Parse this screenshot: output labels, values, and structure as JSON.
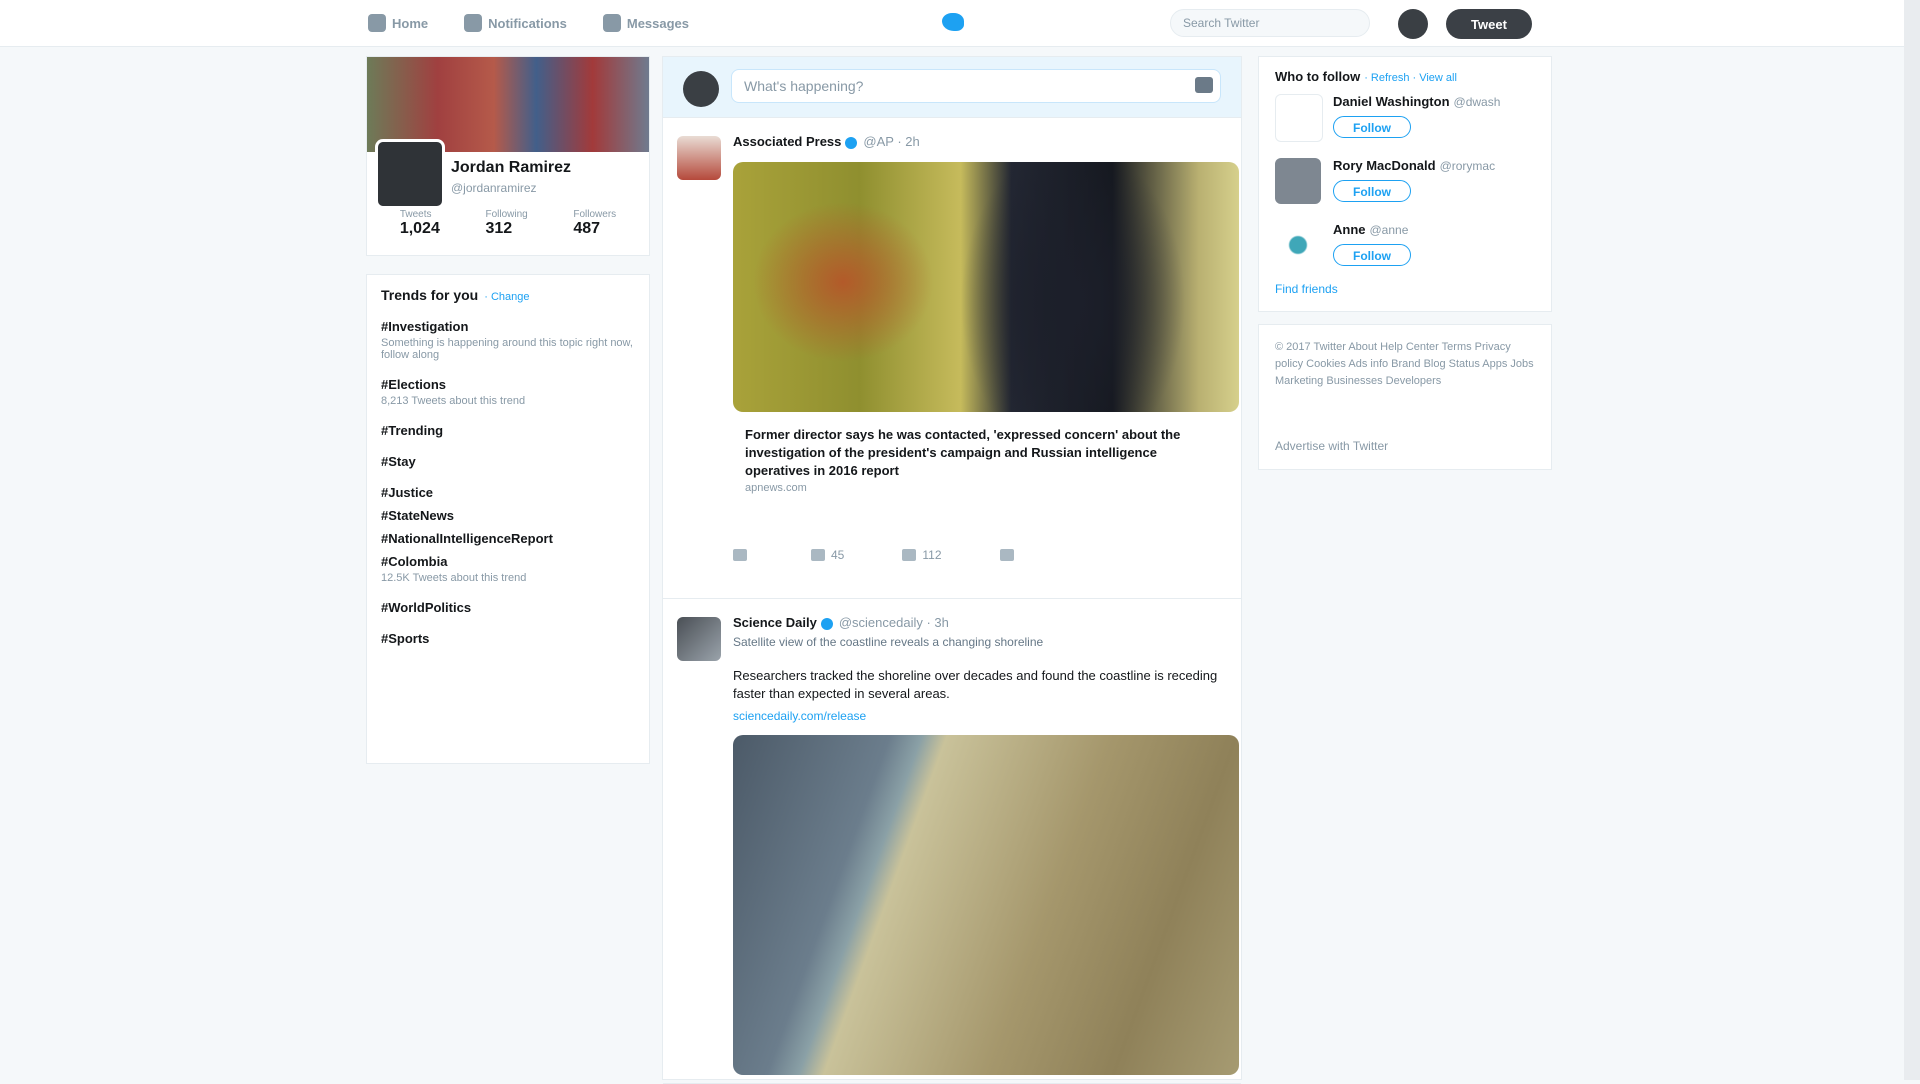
{
  "topbar": {
    "nav": [
      {
        "label": "Home",
        "icon": "home-icon"
      },
      {
        "label": "Notifications",
        "icon": "bell-icon"
      },
      {
        "label": "Messages",
        "icon": "envelope-icon"
      }
    ],
    "search_placeholder": "Search Twitter",
    "tweet_button": "Tweet"
  },
  "profile": {
    "name": "Jordan Ramirez",
    "handle": "@jordanramirez",
    "stats": [
      {
        "label": "Tweets",
        "value": "1,024"
      },
      {
        "label": "Following",
        "value": "312"
      },
      {
        "label": "Followers",
        "value": "487"
      }
    ]
  },
  "trends": {
    "header": "Trends for you",
    "change_label": "· Change",
    "items": [
      {
        "name": "#Investigation",
        "sub": "Something is happening around this topic right now, follow along"
      },
      {
        "name": "#Elections",
        "sub": "8,213 Tweets about this trend"
      },
      {
        "name": "#Trending",
        "sub": ""
      },
      {
        "name": "#Stay",
        "sub": ""
      },
      {
        "name": "#Justice",
        "sub": ""
      },
      {
        "name": "#StateNews",
        "sub": ""
      },
      {
        "name": "#NationalIntelligenceReport",
        "sub": ""
      },
      {
        "name": "#Colombia",
        "sub": "12.5K Tweets about this trend"
      },
      {
        "name": "#WorldPolitics",
        "sub": ""
      },
      {
        "name": "#Sports",
        "sub": ""
      }
    ]
  },
  "composer": {
    "placeholder": "What's happening?"
  },
  "tweets": [
    {
      "author": "Associated Press",
      "meta": "@AP · 2h",
      "card_title": "Former director says he was contacted, 'expressed concern' about the investigation of the president's campaign and Russian intelligence operatives in 2016 report",
      "card_link": "apnews.com",
      "actions": [
        {
          "label": "Reply",
          "count": ""
        },
        {
          "label": "Retweet",
          "count": "45"
        },
        {
          "label": "Like",
          "count": "112"
        },
        {
          "label": "Message",
          "count": ""
        }
      ]
    },
    {
      "author": "Science Daily",
      "meta": "@sciencedaily · 3h",
      "text_sub": "Satellite view of the coastline reveals a changing shoreline",
      "text": "Researchers tracked the shoreline over decades and found the coastline is receding faster than expected in several areas.",
      "link": "sciencedaily.com/release"
    }
  ],
  "who_to_follow": {
    "header": "Who to follow",
    "links": "· Refresh · View all",
    "suggestions": [
      {
        "name": "Daniel Washington",
        "handle": "@dwash",
        "follow": "Follow"
      },
      {
        "name": "Rory MacDonald",
        "handle": "@rorymac",
        "follow": "Follow"
      },
      {
        "name": "Anne",
        "handle": "@anne",
        "follow": "Follow"
      }
    ],
    "find_friends": "Find friends"
  },
  "footer": {
    "text": "© 2017 Twitter About Help Center Terms Privacy policy Cookies Ads info Brand Blog Status Apps Jobs Marketing Businesses Developers",
    "ads": "Advertise with Twitter"
  },
  "colors": {
    "accent": "#1da1f2",
    "background": "#f5f8fa"
  }
}
